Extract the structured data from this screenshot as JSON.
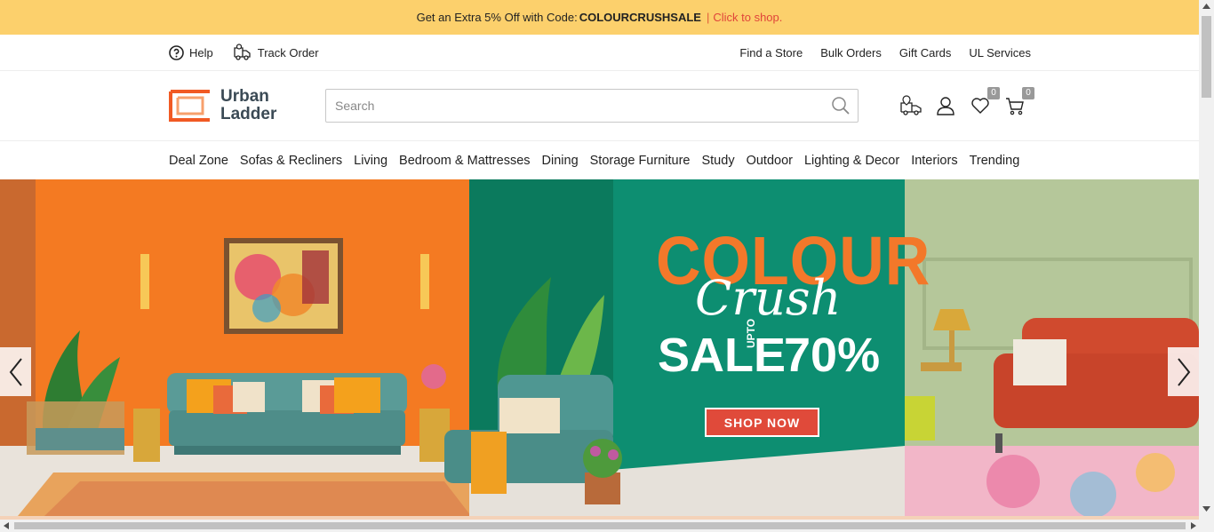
{
  "promo": {
    "text": "Get an Extra 5% Off with Code:",
    "code": "COLOURCRUSHSALE",
    "separator": "|",
    "link": "Click to shop."
  },
  "util": {
    "help": "Help",
    "track": "Track Order",
    "links": [
      "Find a Store",
      "Bulk Orders",
      "Gift Cards",
      "UL Services"
    ]
  },
  "logo": {
    "line1": "Urban",
    "line2": "Ladder"
  },
  "search": {
    "placeholder": "Search",
    "value": ""
  },
  "icons": {
    "wishlist_count": "0",
    "cart_count": "0"
  },
  "nav": [
    "Deal Zone",
    "Sofas & Recliners",
    "Living",
    "Bedroom & Mattresses",
    "Dining",
    "Storage Furniture",
    "Study",
    "Outdoor",
    "Lighting & Decor",
    "Interiors",
    "Trending"
  ],
  "hero": {
    "headline": "COLOUR",
    "script": "Crush",
    "sale": "SALE",
    "upto": "UPTO",
    "percent": "70%",
    "cta": "SHOP NOW"
  },
  "colors": {
    "promo_bg": "#fcd06c",
    "brand_orange": "#f15a24",
    "cta_red": "#e04a3a",
    "hero_green": "#0d8e71"
  }
}
